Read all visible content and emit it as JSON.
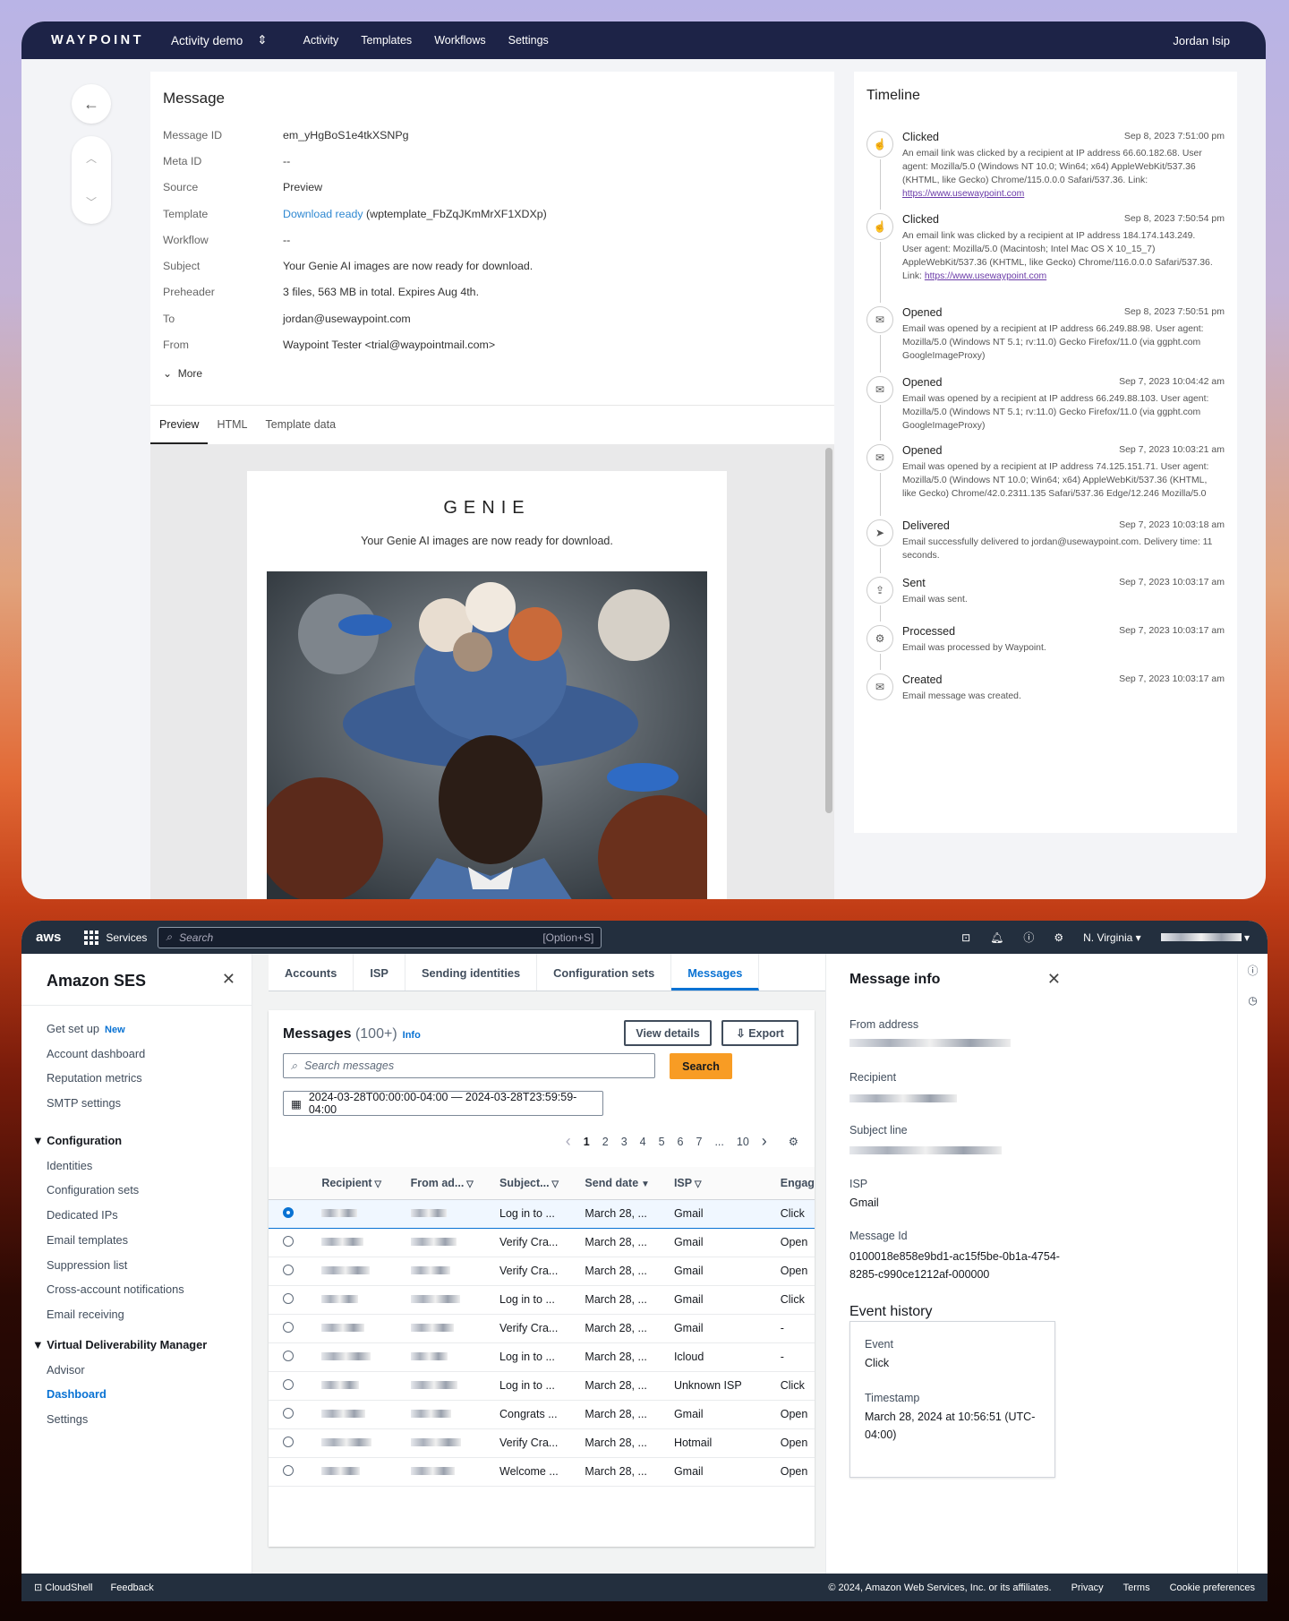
{
  "waypoint": {
    "logo": "WAYPOINT",
    "workspace": "Activity demo",
    "nav": [
      "Activity",
      "Templates",
      "Workflows",
      "Settings"
    ],
    "user": "Jordan Isip",
    "message": {
      "title": "Message",
      "fields": [
        {
          "k": "Message ID",
          "v": "em_yHgBoS1e4tkXSNPg"
        },
        {
          "k": "Meta ID",
          "v": "--"
        },
        {
          "k": "Source",
          "v": "Preview"
        },
        {
          "k": "Template",
          "link": "Download ready",
          "v": "(wptemplate_FbZqJKmMrXF1XDXp)"
        },
        {
          "k": "Workflow",
          "v": "--"
        },
        {
          "k": "Subject",
          "v": "Your Genie AI images are now ready for download."
        },
        {
          "k": "Preheader",
          "v": "3 files, 563 MB in total. Expires Aug 4th."
        },
        {
          "k": "To",
          "v": "jordan@usewaypoint.com"
        },
        {
          "k": "From",
          "v": "Waypoint Tester <trial@waypointmail.com>"
        }
      ],
      "more": "More",
      "tabs": [
        "Preview",
        "HTML",
        "Template data"
      ],
      "preview": {
        "brand": "GENIE",
        "subtitle": "Your Genie AI images are now ready for download."
      }
    },
    "timeline": {
      "title": "Timeline",
      "events": [
        {
          "title": "Clicked",
          "date": "Sep 8, 2023 7:51:00 pm",
          "icon": "pointer-icon",
          "desc": "An email link was clicked by a recipient at IP address 66.60.182.68. User agent: Mozilla/5.0 (Windows NT 10.0; Win64; x64) AppleWebKit/537.36 (KHTML, like Gecko) Chrome/115.0.0.0 Safari/537.36. Link: ",
          "link": "https://www.usewaypoint.com"
        },
        {
          "title": "Clicked",
          "date": "Sep 8, 2023 7:50:54 pm",
          "icon": "pointer-icon",
          "desc": "An email link was clicked by a recipient at IP address 184.174.143.249. User agent: Mozilla/5.0 (Macintosh; Intel Mac OS X 10_15_7) AppleWebKit/537.36 (KHTML, like Gecko) Chrome/116.0.0.0 Safari/537.36. Link: ",
          "link": "https://www.usewaypoint.com"
        },
        {
          "title": "Opened",
          "date": "Sep 8, 2023 7:50:51 pm",
          "icon": "envelope-open-icon",
          "desc": "Email was opened by a recipient at IP address 66.249.88.98. User agent: Mozilla/5.0 (Windows NT 5.1; rv:11.0) Gecko Firefox/11.0 (via ggpht.com GoogleImageProxy)"
        },
        {
          "title": "Opened",
          "date": "Sep 7, 2023 10:04:42 am",
          "icon": "envelope-open-icon",
          "desc": "Email was opened by a recipient at IP address 66.249.88.103. User agent: Mozilla/5.0 (Windows NT 5.1; rv:11.0) Gecko Firefox/11.0 (via ggpht.com GoogleImageProxy)"
        },
        {
          "title": "Opened",
          "date": "Sep 7, 2023 10:03:21 am",
          "icon": "envelope-open-icon",
          "desc": "Email was opened by a recipient at IP address 74.125.151.71. User agent: Mozilla/5.0 (Windows NT 10.0; Win64; x64) AppleWebKit/537.36 (KHTML, like Gecko) Chrome/42.0.2311.135 Safari/537.36 Edge/12.246 Mozilla/5.0"
        },
        {
          "title": "Delivered",
          "date": "Sep 7, 2023 10:03:18 am",
          "icon": "send-icon",
          "desc": "Email successfully delivered to jordan@usewaypoint.com. Delivery time: 11 seconds."
        },
        {
          "title": "Sent",
          "date": "Sep 7, 2023 10:03:17 am",
          "icon": "outbox-icon",
          "desc": "Email was sent."
        },
        {
          "title": "Processed",
          "date": "Sep 7, 2023 10:03:17 am",
          "icon": "gear-icon",
          "desc": "Email was processed by Waypoint."
        },
        {
          "title": "Created",
          "date": "Sep 7, 2023 10:03:17 am",
          "icon": "envelope-icon",
          "desc": "Email message was created."
        }
      ]
    }
  },
  "aws": {
    "logo": "aws",
    "services": "Services",
    "search_placeholder": "Search",
    "search_shortcut": "[Option+S]",
    "region": "N. Virginia",
    "sidebar": {
      "title": "Amazon SES",
      "top": [
        {
          "label": "Get set up",
          "badge": "New"
        },
        {
          "label": "Account dashboard"
        },
        {
          "label": "Reputation metrics"
        },
        {
          "label": "SMTP settings"
        }
      ],
      "config_title": "Configuration",
      "config": [
        "Identities",
        "Configuration sets",
        "Dedicated IPs",
        "Email templates",
        "Suppression list",
        "Cross-account notifications",
        "Email receiving"
      ],
      "vdm_title": "Virtual Deliverability Manager",
      "vdm": [
        "Advisor",
        "Dashboard",
        "Settings"
      ]
    },
    "tabs": [
      "Accounts",
      "ISP",
      "Sending identities",
      "Configuration sets",
      "Messages"
    ],
    "messages": {
      "title": "Messages",
      "count": "(100+)",
      "info": "Info",
      "view_details": "View details",
      "export": "Export",
      "search_placeholder": "Search messages",
      "search_button": "Search",
      "date_range": "2024-03-28T00:00:00-04:00 — 2024-03-28T23:59:59-04:00",
      "pages": [
        "1",
        "2",
        "3",
        "4",
        "5",
        "6",
        "7",
        "...",
        "10"
      ],
      "columns": [
        "Recipient",
        "From ad...",
        "Subject...",
        "Send date",
        "ISP",
        "Engag"
      ],
      "rows": [
        {
          "subject": "Log in to ...",
          "date": "March 28, ...",
          "isp": "Gmail",
          "eng": "Click"
        },
        {
          "subject": "Verify Cra...",
          "date": "March 28, ...",
          "isp": "Gmail",
          "eng": "Open"
        },
        {
          "subject": "Verify Cra...",
          "date": "March 28, ...",
          "isp": "Gmail",
          "eng": "Open"
        },
        {
          "subject": "Log in to ...",
          "date": "March 28, ...",
          "isp": "Gmail",
          "eng": "Click"
        },
        {
          "subject": "Verify Cra...",
          "date": "March 28, ...",
          "isp": "Gmail",
          "eng": "-"
        },
        {
          "subject": "Log in to ...",
          "date": "March 28, ...",
          "isp": "Icloud",
          "eng": "-"
        },
        {
          "subject": "Log in to ...",
          "date": "March 28, ...",
          "isp": "Unknown ISP",
          "eng": "Click"
        },
        {
          "subject": "Congrats ...",
          "date": "March 28, ...",
          "isp": "Gmail",
          "eng": "Open"
        },
        {
          "subject": "Verify Cra...",
          "date": "March 28, ...",
          "isp": "Hotmail",
          "eng": "Open"
        },
        {
          "subject": "Welcome ...",
          "date": "March 28, ...",
          "isp": "Gmail",
          "eng": "Open"
        }
      ]
    },
    "info_panel": {
      "title": "Message info",
      "from_label": "From address",
      "recipient_label": "Recipient",
      "subject_label": "Subject line",
      "isp_label": "ISP",
      "isp": "Gmail",
      "msgid_label": "Message Id",
      "msgid": "0100018e858e9bd1-ac15f5be-0b1a-4754-8285-c990ce1212af-000000",
      "history_title": "Event history",
      "event_label": "Event",
      "event": "Click",
      "timestamp_label": "Timestamp",
      "timestamp": "March 28, 2024 at 10:56:51 (UTC-04:00)"
    },
    "footer": {
      "cloudshell": "CloudShell",
      "feedback": "Feedback",
      "copyright": "© 2024, Amazon Web Services, Inc. or its affiliates.",
      "links": [
        "Privacy",
        "Terms",
        "Cookie preferences"
      ]
    }
  }
}
